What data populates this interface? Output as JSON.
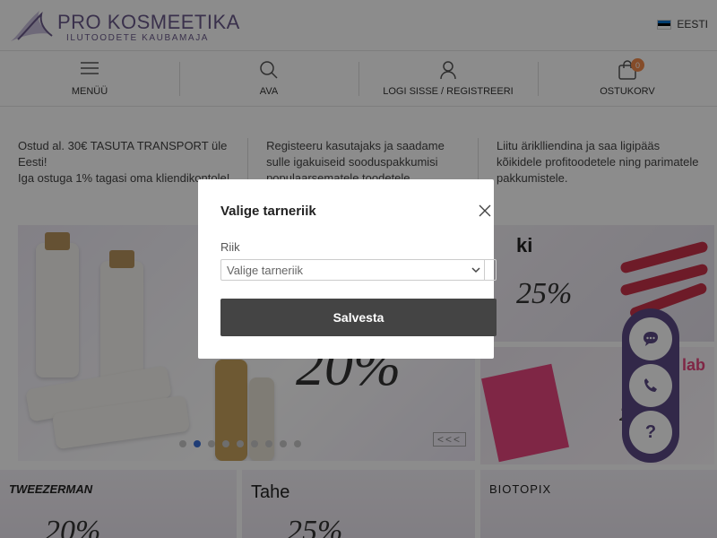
{
  "header": {
    "logo_title": "PRO KOSMEETIKA",
    "logo_subtitle": "ILUTOODETE KAUBAMAJA",
    "language": "EESTI",
    "flag_colors": [
      "#0072CE",
      "#000000",
      "#FFFFFF"
    ]
  },
  "nav": {
    "menu_label": "MENÜÜ",
    "search_label": "AVA",
    "login_label": "LOGI SISSE / REGISTREERI",
    "cart_label": "OSTUKORV",
    "cart_count": "0",
    "cart_badge_color": "#F28B4B"
  },
  "info": {
    "col1": "Ostud al. 30€ TASUTA TRANSPORT üle Eesti!\nIga ostuga 1% tagasi oma kliendikontole!",
    "col2": "Registeeru kasutajaks ja saadame sulle igakuiseid sooduspakkumisi populaarsematele toodetele",
    "col3": "Liitu äriklliendina ja saa ligipääs kõikidele profitoodetele ning parimatele pakkumistele."
  },
  "banners": {
    "main_percent": "20%",
    "right_top_text": "ki",
    "right_top_percent": "25%",
    "right_bottom_text": "lab",
    "right_bottom_percent": "2",
    "slider_arrows": "<<<",
    "slider_dots": 9,
    "slider_active_dot": 1,
    "brands": [
      {
        "name": "TWEEZERMAN",
        "percent": "20%"
      },
      {
        "name": "Tahe",
        "percent": "25%"
      },
      {
        "name": "BIOTOPIX",
        "percent": ""
      }
    ]
  },
  "widget": {
    "help_label": "?",
    "accent": "#5B4A86"
  },
  "modal": {
    "title": "Valige tarneriik",
    "field_label": "Riik",
    "select_value": "Valige tarneriik",
    "save_label": "Salvesta",
    "button_color": "#444444"
  }
}
